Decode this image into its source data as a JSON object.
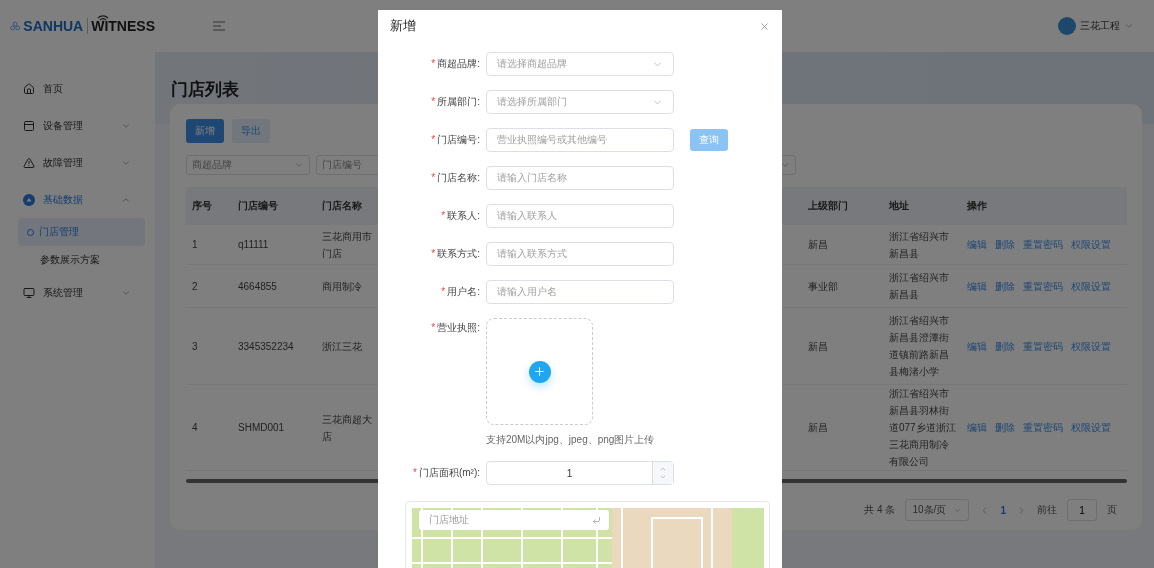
{
  "sidebar": {
    "logo": {
      "brand": "SANHUA",
      "product": "WITNESS"
    },
    "items": [
      {
        "label": "首页",
        "selected": false
      },
      {
        "label": "设备管理",
        "selected": false,
        "expanded": false
      },
      {
        "label": "故障管理",
        "selected": false,
        "expanded": false
      },
      {
        "label": "基础数据",
        "selected": true,
        "expanded": true,
        "children": [
          {
            "label": "门店管理",
            "selected": true
          },
          {
            "label": "参数展示方案",
            "selected": false
          }
        ]
      },
      {
        "label": "系统管理",
        "selected": false,
        "expanded": false
      }
    ]
  },
  "header": {
    "user": "三花工程"
  },
  "page": {
    "title": "门店列表",
    "buttons": [
      {
        "label": "新增",
        "kind": "primary"
      },
      {
        "label": "导出",
        "kind": "plain"
      }
    ],
    "filters": [
      {
        "kind": "select",
        "placeholder": "商超品牌"
      },
      {
        "kind": "input",
        "placeholder": "门店编号"
      },
      {
        "kind": "select"
      }
    ],
    "table": {
      "columns": [
        "序号",
        "门店编号",
        "门店名称",
        "上级部门",
        "地址",
        "操作"
      ],
      "rows": [
        {
          "cells": [
            "1",
            "q11111",
            "三花商用市门店",
            "新昌",
            "浙江省绍兴市新昌县"
          ],
          "actions": [
            "编辑",
            "删除",
            "重置密码",
            "权限设置"
          ]
        },
        {
          "cells": [
            "2",
            "4664855",
            "商用制冷",
            "事业部",
            "浙江省绍兴市新昌县"
          ],
          "actions": [
            "编辑",
            "删除",
            "重置密码",
            "权限设置"
          ]
        },
        {
          "cells": [
            "3",
            "3345352234",
            "浙江三花",
            "新昌",
            "浙江省绍兴市新昌县澄潭街道镇前路新昌县梅渚小学"
          ],
          "actions": [
            "编辑",
            "删除",
            "重置密码",
            "权限设置"
          ]
        },
        {
          "cells": [
            "4",
            "SHMD001",
            "三花商超大店",
            "新昌",
            "浙江省绍兴市新昌县羽林街道077乡道浙江三花商用制冷有限公司"
          ],
          "actions": [
            "编辑",
            "删除",
            "重置密码",
            "权限设置"
          ]
        }
      ]
    },
    "pagination": {
      "total": "共 4 条",
      "page_size": "10条/页",
      "pages": [
        {
          "label": "1",
          "selected": true
        }
      ],
      "goto_label": "前往",
      "goto_value": "1",
      "goto_suffix": "页"
    }
  },
  "modal": {
    "title": "新增",
    "fields": [
      {
        "kind": "select",
        "mark": "*",
        "label": "商超品牌:",
        "placeholder": "请选择商超品牌"
      },
      {
        "kind": "select",
        "mark": "*",
        "label": "所属部门:",
        "placeholder": "请选择所属部门"
      },
      {
        "kind": "input_button",
        "mark": "*",
        "label": "门店编号:",
        "placeholder": "营业执照编号或其他编号",
        "button": "查询"
      },
      {
        "kind": "input",
        "mark": "*",
        "label": "门店名称:",
        "placeholder": "请输入门店名称"
      },
      {
        "kind": "input",
        "mark": "*",
        "label": "联系人:",
        "placeholder": "请输入联系人"
      },
      {
        "kind": "input",
        "mark": "*",
        "label": "联系方式:",
        "placeholder": "请输入联系方式"
      },
      {
        "kind": "input",
        "mark": "*",
        "label": "用户名:",
        "placeholder": "请输入用户名"
      },
      {
        "kind": "upload",
        "mark": "*",
        "label": "营业执照:",
        "hint": "支持20M以内jpg、jpeg、png图片上传"
      },
      {
        "kind": "number",
        "mark": "*",
        "label": "门店面积(m²):",
        "value": "1"
      }
    ],
    "map": {
      "search_placeholder": "门店地址"
    }
  }
}
